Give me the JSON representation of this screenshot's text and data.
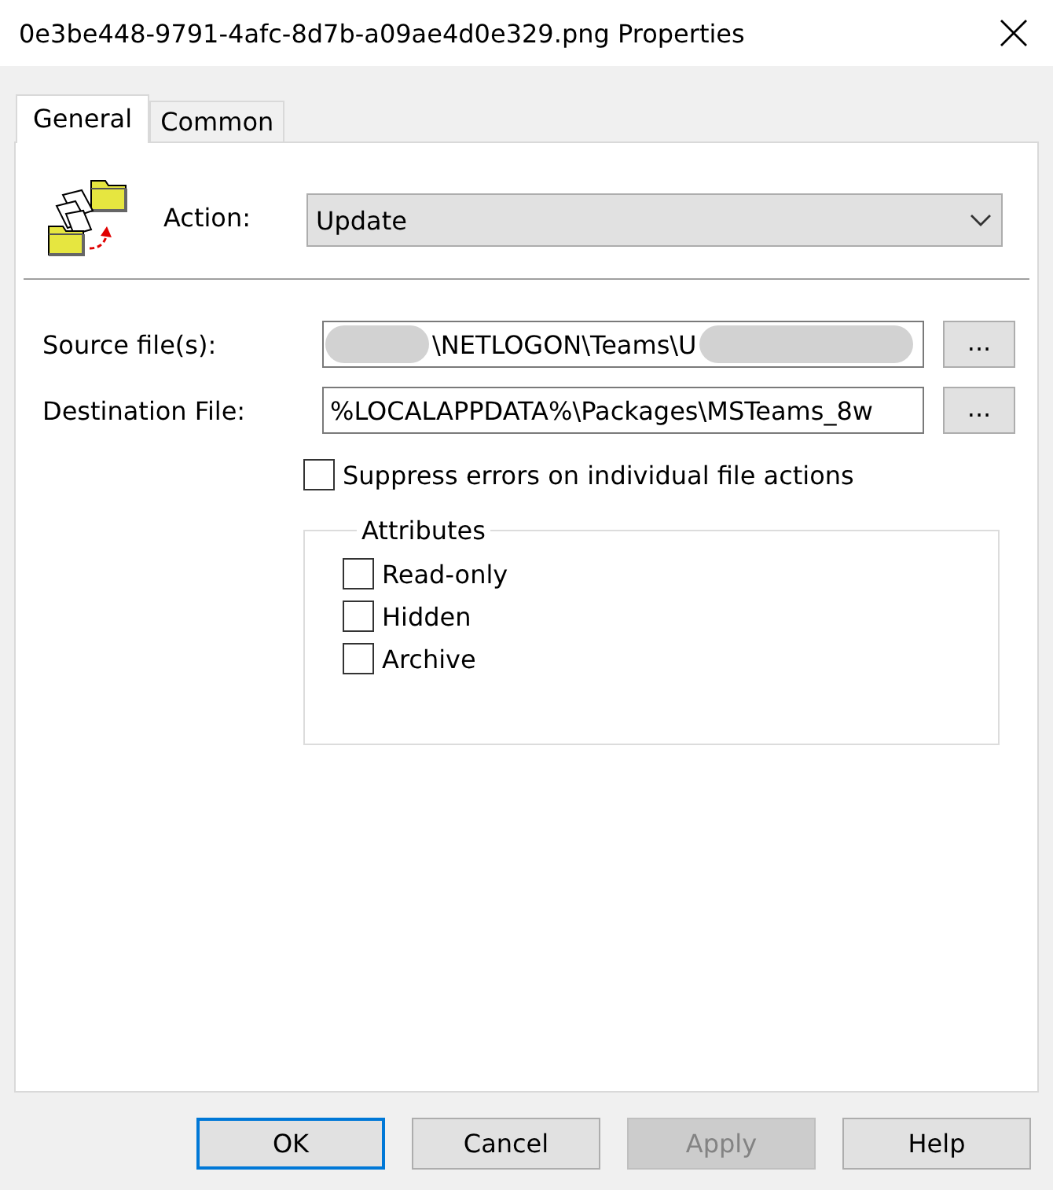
{
  "window": {
    "title": "0e3be448-9791-4afc-8d7b-a09ae4d0e329.png Properties"
  },
  "tabs": [
    {
      "label": "General",
      "selected": true
    },
    {
      "label": "Common",
      "selected": false
    }
  ],
  "action": {
    "label": "Action:",
    "value": "Update"
  },
  "fields": [
    {
      "label": "Source file(s):",
      "value": "\\NETLOGON\\Teams\\U",
      "redacted": true,
      "browse": "..."
    },
    {
      "label": "Destination File:",
      "value": "%LOCALAPPDATA%\\Packages\\MSTeams_8w",
      "redacted": false,
      "browse": "..."
    }
  ],
  "suppress_errors": {
    "label": "Suppress errors on individual file actions",
    "checked": false
  },
  "attributes": {
    "title": "Attributes",
    "items": [
      {
        "label": "Read-only",
        "checked": false
      },
      {
        "label": "Hidden",
        "checked": false
      },
      {
        "label": "Archive",
        "checked": false
      }
    ]
  },
  "buttons": [
    {
      "label": "OK",
      "default": true,
      "disabled": false
    },
    {
      "label": "Cancel",
      "default": false,
      "disabled": false
    },
    {
      "label": "Apply",
      "default": false,
      "disabled": true
    },
    {
      "label": "Help",
      "default": false,
      "disabled": false
    }
  ]
}
